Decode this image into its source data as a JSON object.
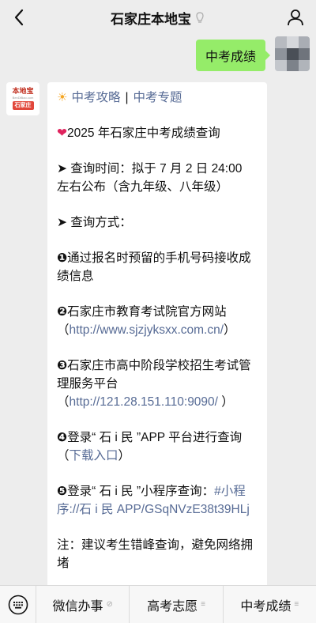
{
  "header": {
    "title": "石家庄本地宝",
    "back_icon": "chevron-left-icon",
    "verified_icon": "badge-icon",
    "profile_icon": "person-icon"
  },
  "outgoing": {
    "text": "中考成绩"
  },
  "bot": {
    "logo_top": "本地宝",
    "logo_url": "BenDiBao.com",
    "logo_badge": "石家庄"
  },
  "message": {
    "link1": "中考攻略",
    "sep": "|",
    "link2": "中考专题",
    "title": "2025 年石家庄中考成绩查询",
    "time_label": "➤ 查询时间：拟于 7 月 2 日 24:00 左右公布（含九年级、八年级）",
    "method_label": "➤ 查询方式：",
    "m1_num": "❶",
    "m1": "通过报名时预留的手机号码接收成绩信息",
    "m2_num": "❷",
    "m2": "石家庄市教育考试院官方网站",
    "m2_paren_open": "（",
    "m2_link": "http://www.sjzjyksxx.com.cn/",
    "m2_paren_close": "）",
    "m3_num": "❸",
    "m3": "石家庄市高中阶段学校招生考试管理服务平台",
    "m3_paren_open": "（",
    "m3_link": "http://121.28.151.110:9090/",
    "m3_paren_close": " ）",
    "m4_num": "❹",
    "m4": "登录“ 石 i 民 ”APP 平台进行查询",
    "m4_paren_open": "（",
    "m4_link": "下载入口",
    "m4_paren_close": "）",
    "m5_num": "❺",
    "m5": "登录“ 石 i 民 ”小程序查询：",
    "m5_link": "#小程序://石 i 民 APP/GSqNVzE38t39HLj",
    "note": "注：建议考生错峰查询，避免网络拥堵"
  },
  "bottom_menu": {
    "keyboard_icon": "keyboard-icon",
    "items": [
      {
        "label": "微信办事",
        "mark": "⊘"
      },
      {
        "label": "高考志愿",
        "mark": "≡"
      },
      {
        "label": "中考成绩",
        "mark": "≡"
      }
    ]
  },
  "colors": {
    "bubble_green": "#95ec69",
    "link_blue": "#576b95",
    "background": "#ededed"
  }
}
